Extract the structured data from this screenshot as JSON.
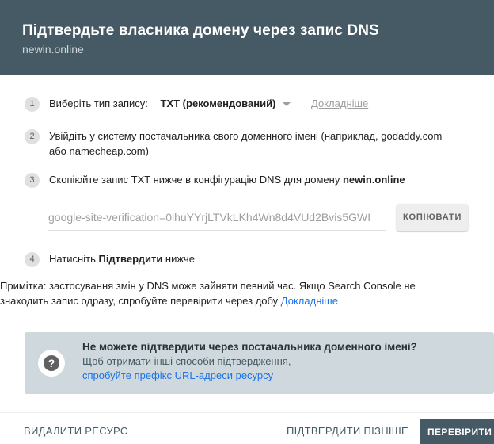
{
  "header": {
    "title": "Підтвердьте власника домену через запис DNS",
    "subtitle": "newin.online"
  },
  "steps": [
    {
      "num": "1",
      "text": "Виберіть тип запису:",
      "select_value": "TXT (рекомендований)",
      "link": "Докладніше"
    },
    {
      "num": "2",
      "line1": "Увійдіть у систему постачальника свого доменного імені (наприклад, godaddy.com",
      "line2": "або namecheap.com)"
    },
    {
      "num": "3",
      "text_before": "Скопіюйте запис TXT нижче в конфігурацію DNS для домену ",
      "domain": "newin.online"
    },
    {
      "num": "4",
      "text_before": "Натисніть ",
      "bold": "Підтвердити",
      "text_after": " нижче"
    }
  ],
  "txt_record": {
    "value": "google-site-verification=0lhuYYrjLTVkLKh4Wn8d4VUd2Bvis5GWI",
    "copy_label": "КОПІЮВАТИ"
  },
  "note": {
    "line1": "Примітка: застосування змін у DNS може зайняти певний час. Якщо Search Console не",
    "line2": "знаходить запис одразу, спробуйте перевірити через добу ",
    "link": "Докладніше"
  },
  "infobox": {
    "icon": "question-icon",
    "title": "Не можете підтвердити через постачальника доменного імені?",
    "body": "Щоб отримати інші способи підтвердження,",
    "link": "спробуйте префікс URL-адреси ресурсу"
  },
  "footer": {
    "delete_label": "ВИДАЛИТИ РЕСУРС",
    "later_label": "ПІДТВЕРДИТИ ПІЗНІШЕ",
    "verify_label": "ПЕРЕВІРИТИ"
  },
  "colors": {
    "header_bg": "#455a64",
    "link": "#1a73e8",
    "infobox_bg": "#cfd8dc"
  }
}
